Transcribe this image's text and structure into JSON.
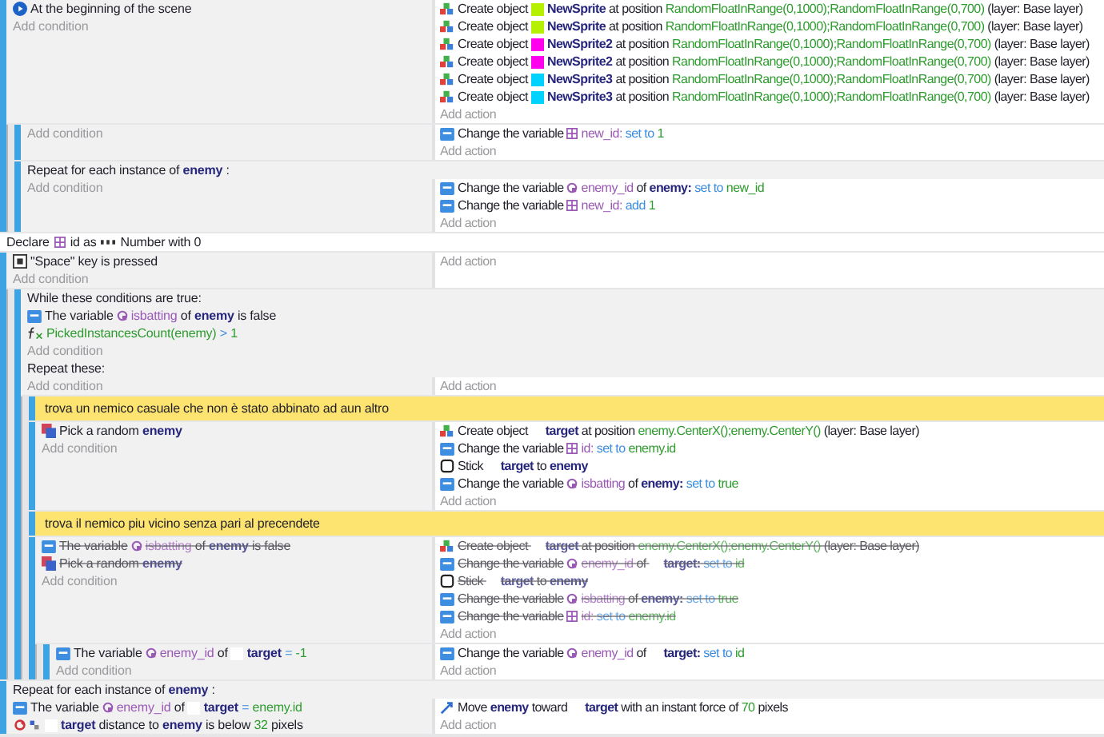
{
  "events": [
    {
      "kind": "standard",
      "conditions": [
        {
          "kind": "scene-start",
          "parts": [
            {
              "kind": "text",
              "text": "At the beginning of the scene"
            }
          ]
        }
      ],
      "add_condition": "Add condition",
      "actions": [
        {
          "kind": "create",
          "parts": [
            {
              "kind": "text",
              "text": "Create object"
            },
            {
              "kind": "object",
              "text": "NewSprite",
              "color": "#b5f000"
            },
            {
              "kind": "text",
              "text": "at position"
            },
            {
              "kind": "value",
              "text": "RandomFloatInRange(0,1000);RandomFloatInRange(0,700)"
            },
            {
              "kind": "text",
              "text": "(layer: Base layer)"
            }
          ]
        },
        {
          "kind": "create",
          "parts": [
            {
              "kind": "text",
              "text": "Create object"
            },
            {
              "kind": "object",
              "text": "NewSprite",
              "color": "#b5f000"
            },
            {
              "kind": "text",
              "text": "at position"
            },
            {
              "kind": "value",
              "text": "RandomFloatInRange(0,1000);RandomFloatInRange(0,700)"
            },
            {
              "kind": "text",
              "text": "(layer: Base layer)"
            }
          ]
        },
        {
          "kind": "create",
          "parts": [
            {
              "kind": "text",
              "text": "Create object"
            },
            {
              "kind": "object",
              "text": "NewSprite2",
              "color": "#ff00ee"
            },
            {
              "kind": "text",
              "text": "at position"
            },
            {
              "kind": "value",
              "text": "RandomFloatInRange(0,1000);RandomFloatInRange(0,700)"
            },
            {
              "kind": "text",
              "text": "(layer: Base layer)"
            }
          ]
        },
        {
          "kind": "create",
          "parts": [
            {
              "kind": "text",
              "text": "Create object"
            },
            {
              "kind": "object",
              "text": "NewSprite2",
              "color": "#ff00ee"
            },
            {
              "kind": "text",
              "text": "at position"
            },
            {
              "kind": "value",
              "text": "RandomFloatInRange(0,1000);RandomFloatInRange(0,700)"
            },
            {
              "kind": "text",
              "text": "(layer: Base layer)"
            }
          ]
        },
        {
          "kind": "create",
          "parts": [
            {
              "kind": "text",
              "text": "Create object"
            },
            {
              "kind": "object",
              "text": "NewSprite3",
              "color": "#00d2ff"
            },
            {
              "kind": "text",
              "text": "at position"
            },
            {
              "kind": "value",
              "text": "RandomFloatInRange(0,1000);RandomFloatInRange(0,700)"
            },
            {
              "kind": "text",
              "text": "(layer: Base layer)"
            }
          ]
        },
        {
          "kind": "create",
          "parts": [
            {
              "kind": "text",
              "text": "Create object"
            },
            {
              "kind": "object",
              "text": "NewSprite3",
              "color": "#00d2ff"
            },
            {
              "kind": "text",
              "text": "at position"
            },
            {
              "kind": "value",
              "text": "RandomFloatInRange(0,1000);RandomFloatInRange(0,700)"
            },
            {
              "kind": "text",
              "text": "(layer: Base layer)"
            }
          ]
        }
      ],
      "add_action": "Add action",
      "children": [
        {
          "kind": "standard",
          "add_condition": "Add condition",
          "actions": [
            {
              "kind": "variable",
              "parts": [
                {
                  "kind": "text",
                  "text": "Change the variable"
                },
                {
                  "kind": "scene_var",
                  "text": "new_id:"
                },
                {
                  "kind": "op",
                  "text": "set to"
                },
                {
                  "kind": "value",
                  "text": "1"
                }
              ]
            }
          ],
          "add_action": "Add action"
        },
        {
          "kind": "repeat",
          "header": [
            {
              "kind": "text",
              "text": "Repeat for each instance of"
            },
            {
              "kind": "object",
              "text": "enemy"
            },
            {
              "kind": "text",
              "text": ":"
            }
          ],
          "add_condition": "Add condition",
          "actions": [
            {
              "kind": "variable",
              "parts": [
                {
                  "kind": "text",
                  "text": "Change the variable"
                },
                {
                  "kind": "object_var",
                  "text": "enemy_id"
                },
                {
                  "kind": "text",
                  "text": "of"
                },
                {
                  "kind": "object",
                  "text": "enemy:"
                },
                {
                  "kind": "op",
                  "text": "set to"
                },
                {
                  "kind": "value",
                  "text": "new_id"
                }
              ]
            },
            {
              "kind": "variable",
              "parts": [
                {
                  "kind": "text",
                  "text": "Change the variable"
                },
                {
                  "kind": "scene_var",
                  "text": "new_id:"
                },
                {
                  "kind": "op",
                  "text": "add"
                },
                {
                  "kind": "value",
                  "text": "1"
                }
              ]
            }
          ],
          "add_action": "Add action"
        }
      ]
    },
    {
      "kind": "declare",
      "parts": [
        {
          "kind": "text",
          "text": "Declare"
        },
        {
          "kind": "declared_var",
          "text": "id"
        },
        {
          "kind": "text",
          "text": "as"
        },
        {
          "kind": "type",
          "text": "Number"
        },
        {
          "kind": "text",
          "text": "with 0"
        }
      ]
    },
    {
      "kind": "standard",
      "conditions": [
        {
          "kind": "key",
          "parts": [
            {
              "kind": "text",
              "text": "\"Space\" key is pressed"
            }
          ]
        }
      ],
      "add_condition": "Add condition",
      "add_action": "Add action",
      "children": [
        {
          "kind": "while",
          "header_label": "While these conditions are true:",
          "while_conditions": [
            {
              "kind": "variable",
              "parts": [
                {
                  "kind": "text",
                  "text": "The variable"
                },
                {
                  "kind": "object_var",
                  "text": "isbatting"
                },
                {
                  "kind": "text",
                  "text": "of"
                },
                {
                  "kind": "object",
                  "text": "enemy"
                },
                {
                  "kind": "text",
                  "text": "is false"
                }
              ]
            },
            {
              "kind": "function",
              "parts": [
                {
                  "kind": "value",
                  "text": "PickedInstancesCount(enemy)"
                },
                {
                  "kind": "op",
                  "text": ">"
                },
                {
                  "kind": "value",
                  "text": "1"
                }
              ]
            }
          ],
          "while_add_condition": "Add condition",
          "repeat_label": "Repeat these:",
          "add_condition": "Add condition",
          "add_action": "Add action",
          "children": [
            {
              "kind": "comment",
              "text": "trova un nemico casuale che non è stato abbinato ad aun altro"
            },
            {
              "kind": "standard",
              "conditions": [
                {
                  "kind": "random",
                  "parts": [
                    {
                      "kind": "text",
                      "text": "Pick a random"
                    },
                    {
                      "kind": "object",
                      "text": "enemy"
                    }
                  ]
                }
              ],
              "add_condition": "Add condition",
              "actions": [
                {
                  "kind": "create",
                  "parts": [
                    {
                      "kind": "text",
                      "text": "Create object"
                    },
                    {
                      "kind": "object_spaced",
                      "text": "target"
                    },
                    {
                      "kind": "text",
                      "text": "at position"
                    },
                    {
                      "kind": "value",
                      "text": "enemy.CenterX();enemy.CenterY()"
                    },
                    {
                      "kind": "text",
                      "text": "(layer: Base layer)"
                    }
                  ]
                },
                {
                  "kind": "variable",
                  "parts": [
                    {
                      "kind": "text",
                      "text": "Change the variable"
                    },
                    {
                      "kind": "scene_var",
                      "text": "id:"
                    },
                    {
                      "kind": "op",
                      "text": "set to"
                    },
                    {
                      "kind": "value",
                      "text": "enemy.id"
                    }
                  ]
                },
                {
                  "kind": "stick",
                  "parts": [
                    {
                      "kind": "text",
                      "text": "Stick"
                    },
                    {
                      "kind": "object_spaced",
                      "text": "target"
                    },
                    {
                      "kind": "text",
                      "text": "to"
                    },
                    {
                      "kind": "object",
                      "text": "enemy"
                    }
                  ]
                },
                {
                  "kind": "variable",
                  "parts": [
                    {
                      "kind": "text",
                      "text": "Change the variable"
                    },
                    {
                      "kind": "object_var",
                      "text": "isbatting"
                    },
                    {
                      "kind": "text",
                      "text": "of"
                    },
                    {
                      "kind": "object",
                      "text": "enemy:"
                    },
                    {
                      "kind": "op",
                      "text": "set to"
                    },
                    {
                      "kind": "value",
                      "text": "true"
                    }
                  ]
                }
              ],
              "add_action": "Add action"
            },
            {
              "kind": "comment",
              "text": "trova il nemico piu vicino senza pari al precendete"
            },
            {
              "kind": "standard",
              "conditions": [
                {
                  "kind": "variable",
                  "disabled": true,
                  "parts": [
                    {
                      "kind": "text",
                      "text": "The variable"
                    },
                    {
                      "kind": "object_var",
                      "text": "isbatting"
                    },
                    {
                      "kind": "text",
                      "text": "of"
                    },
                    {
                      "kind": "object",
                      "text": "enemy"
                    },
                    {
                      "kind": "text",
                      "text": "is false"
                    }
                  ]
                },
                {
                  "kind": "random",
                  "disabled": true,
                  "parts": [
                    {
                      "kind": "text",
                      "text": "Pick a random"
                    },
                    {
                      "kind": "object",
                      "text": "enemy"
                    }
                  ]
                }
              ],
              "add_condition": "Add condition",
              "actions": [
                {
                  "kind": "create",
                  "disabled": true,
                  "parts": [
                    {
                      "kind": "text",
                      "text": "Create object"
                    },
                    {
                      "kind": "object_spaced",
                      "text": "target"
                    },
                    {
                      "kind": "text",
                      "text": "at position"
                    },
                    {
                      "kind": "value",
                      "text": "enemy.CenterX();enemy.CenterY()"
                    },
                    {
                      "kind": "text",
                      "text": "(layer: Base layer)"
                    }
                  ]
                },
                {
                  "kind": "variable",
                  "disabled": true,
                  "parts": [
                    {
                      "kind": "text",
                      "text": "Change the variable"
                    },
                    {
                      "kind": "object_var",
                      "text": "enemy_id"
                    },
                    {
                      "kind": "text",
                      "text": "of"
                    },
                    {
                      "kind": "object_spaced",
                      "text": "target:"
                    },
                    {
                      "kind": "op",
                      "text": "set to"
                    },
                    {
                      "kind": "value",
                      "text": "id"
                    }
                  ]
                },
                {
                  "kind": "stick",
                  "disabled": true,
                  "parts": [
                    {
                      "kind": "text",
                      "text": "Stick"
                    },
                    {
                      "kind": "object_spaced",
                      "text": "target"
                    },
                    {
                      "kind": "text",
                      "text": "to"
                    },
                    {
                      "kind": "object",
                      "text": "enemy"
                    }
                  ]
                },
                {
                  "kind": "variable",
                  "disabled": true,
                  "parts": [
                    {
                      "kind": "text",
                      "text": "Change the variable"
                    },
                    {
                      "kind": "object_var",
                      "text": "isbatting"
                    },
                    {
                      "kind": "text",
                      "text": "of"
                    },
                    {
                      "kind": "object",
                      "text": "enemy:"
                    },
                    {
                      "kind": "op",
                      "text": "set to"
                    },
                    {
                      "kind": "value",
                      "text": "true"
                    }
                  ]
                },
                {
                  "kind": "variable",
                  "disabled": true,
                  "parts": [
                    {
                      "kind": "text",
                      "text": "Change the variable"
                    },
                    {
                      "kind": "scene_var",
                      "text": "id:"
                    },
                    {
                      "kind": "op",
                      "text": "set to"
                    },
                    {
                      "kind": "value",
                      "text": "enemy.id"
                    }
                  ]
                }
              ],
              "add_action": "Add action",
              "children": [
                {
                  "kind": "standard",
                  "conditions": [
                    {
                      "kind": "variable",
                      "parts": [
                        {
                          "kind": "text",
                          "text": "The variable"
                        },
                        {
                          "kind": "object_var",
                          "text": "enemy_id"
                        },
                        {
                          "kind": "text",
                          "text": "of"
                        },
                        {
                          "kind": "object",
                          "text": "target",
                          "color": "#ffffff"
                        },
                        {
                          "kind": "op",
                          "text": "="
                        },
                        {
                          "kind": "value",
                          "text": "-1"
                        }
                      ]
                    }
                  ],
                  "add_condition": "Add condition",
                  "actions": [
                    {
                      "kind": "variable",
                      "parts": [
                        {
                          "kind": "text",
                          "text": "Change the variable"
                        },
                        {
                          "kind": "object_var",
                          "text": "enemy_id"
                        },
                        {
                          "kind": "text",
                          "text": "of"
                        },
                        {
                          "kind": "object_spaced",
                          "text": "target:"
                        },
                        {
                          "kind": "op",
                          "text": "set to"
                        },
                        {
                          "kind": "value",
                          "text": "id"
                        }
                      ]
                    }
                  ],
                  "add_action": "Add action"
                }
              ]
            }
          ]
        }
      ]
    },
    {
      "kind": "repeat",
      "header": [
        {
          "kind": "text",
          "text": "Repeat for each instance of"
        },
        {
          "kind": "object",
          "text": "enemy"
        },
        {
          "kind": "text",
          "text": ":"
        }
      ],
      "conditions": [
        {
          "kind": "variable",
          "parts": [
            {
              "kind": "text",
              "text": "The variable"
            },
            {
              "kind": "object_var",
              "text": "enemy_id"
            },
            {
              "kind": "text",
              "text": "of"
            },
            {
              "kind": "object",
              "text": "target",
              "color": "#ffffff"
            },
            {
              "kind": "op",
              "text": "="
            },
            {
              "kind": "value",
              "text": "enemy.id"
            }
          ]
        },
        {
          "kind": "distance",
          "parts": [
            {
              "kind": "object",
              "text": "target",
              "color": "#ffffff"
            },
            {
              "kind": "text",
              "text": "distance to"
            },
            {
              "kind": "object",
              "text": "enemy"
            },
            {
              "kind": "text",
              "text": "is below"
            },
            {
              "kind": "value",
              "text": "32"
            },
            {
              "kind": "text",
              "text": "pixels"
            }
          ]
        }
      ],
      "actions": [
        {
          "kind": "force",
          "parts": [
            {
              "kind": "text",
              "text": "Move"
            },
            {
              "kind": "object",
              "text": "enemy"
            },
            {
              "kind": "text",
              "text": "toward"
            },
            {
              "kind": "object_spaced",
              "text": "target"
            },
            {
              "kind": "text",
              "text": "with an instant force of"
            },
            {
              "kind": "value",
              "text": "70"
            },
            {
              "kind": "text",
              "text": "pixels"
            }
          ]
        }
      ],
      "add_action": "Add action"
    }
  ]
}
